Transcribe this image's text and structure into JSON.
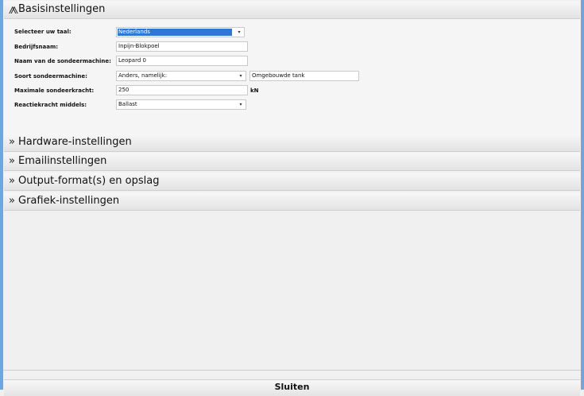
{
  "sections": {
    "basis": {
      "chevron": "»",
      "title": "Basisinstellingen"
    },
    "hardware": {
      "chevron": "»",
      "title": "Hardware-instellingen"
    },
    "email": {
      "chevron": "»",
      "title": "Emailinstellingen"
    },
    "output": {
      "chevron": "»",
      "title": "Output-format(s) en opslag"
    },
    "grafiek": {
      "chevron": "»",
      "title": "Grafiek-instellingen"
    }
  },
  "form": {
    "language": {
      "label": "Selecteer uw taal:",
      "value": "Nederlands",
      "arrow": "▾"
    },
    "company": {
      "label": "Bedrijfsnaam:",
      "value": "Inpijn-Blokpoel"
    },
    "machine_name": {
      "label": "Naam van de sondeermachine:",
      "value": "Leopard 0"
    },
    "machine_type": {
      "label": "Soort sondeermachine:",
      "value": "Anders, namelijk:",
      "arrow": "▾",
      "other_value": "Omgebouwde tank"
    },
    "max_force": {
      "label": "Maximale sondeerkracht:",
      "value": "250",
      "unit": "kN"
    },
    "reaction_force": {
      "label": "Reactiekracht middels:",
      "value": "Ballast",
      "arrow": "▾"
    }
  },
  "footer": {
    "close_label": "Sluiten"
  },
  "colors": {
    "frame": "#6ea6dd",
    "selection": "#3076d6"
  }
}
